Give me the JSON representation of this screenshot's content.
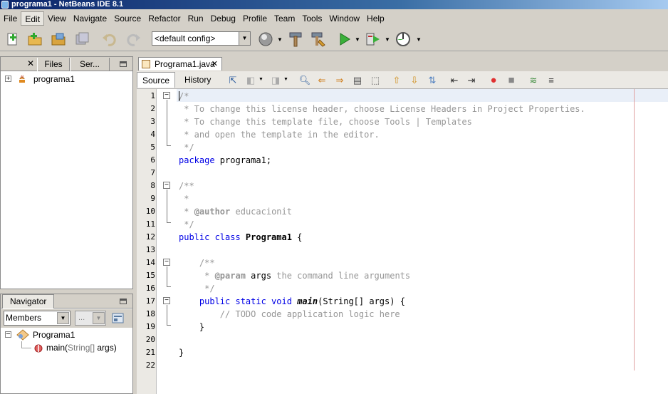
{
  "window": {
    "title": "programa1 - NetBeans IDE 8.1"
  },
  "menu": {
    "items": [
      "File",
      "Edit",
      "View",
      "Navigate",
      "Source",
      "Refactor",
      "Run",
      "Debug",
      "Profile",
      "Team",
      "Tools",
      "Window",
      "Help"
    ],
    "active": "Edit"
  },
  "toolbar": {
    "config_value": "<default config>",
    "icons": [
      "new-file-icon",
      "new-project-icon",
      "open-project-icon",
      "save-all-icon",
      "undo-icon",
      "redo-icon",
      "globe-icon",
      "build-icon",
      "clean-build-icon",
      "run-icon",
      "debug-icon",
      "profile-icon"
    ]
  },
  "projects_panel": {
    "tabs": [
      "Files",
      "Ser..."
    ],
    "tree": [
      {
        "label": "programa1"
      }
    ]
  },
  "navigator": {
    "title": "Navigator",
    "filter_value": "Members",
    "filter_secondary": "...",
    "tree": [
      {
        "label": "Programa1"
      },
      {
        "label_name": "main(",
        "label_type": "String[]",
        "label_rest": " args)"
      }
    ]
  },
  "editor": {
    "file_tab": "Programa1.java",
    "view_tabs": [
      "Source",
      "History"
    ],
    "line_numbers": [
      "1",
      "2",
      "3",
      "4",
      "5",
      "6",
      "7",
      "8",
      "9",
      "10",
      "11",
      "12",
      "13",
      "14",
      "15",
      "16",
      "17",
      "18",
      "19",
      "20",
      "21",
      "22"
    ],
    "code": {
      "l1": "/*",
      "l2": " * To change this license header, choose License Headers in Project Properties.",
      "l3": " * To change this template file, choose Tools | Templates",
      "l4": " * and open the template in the editor.",
      "l5": " */",
      "l6_kw": "package",
      "l6_rest": " programa1;",
      "l8": "/**",
      "l9": " *",
      "l10_a": " * ",
      "l10_tag": "@author",
      "l10_b": " educacionit",
      "l11": " */",
      "l12_kw": "public class",
      "l12_cls": " Programa1",
      "l12_rest": " {",
      "l14": "    /**",
      "l15_a": "     * ",
      "l15_tag": "@param",
      "l15_arg": " args",
      "l15_b": " the command line arguments",
      "l16": "     */",
      "l17_ind": "    ",
      "l17_kw": "public static void",
      "l17_sp": " ",
      "l17_m": "main",
      "l17_rest": "(String[] args) {",
      "l18": "        // TODO code application logic here",
      "l19": "    }",
      "l21": "}"
    }
  }
}
